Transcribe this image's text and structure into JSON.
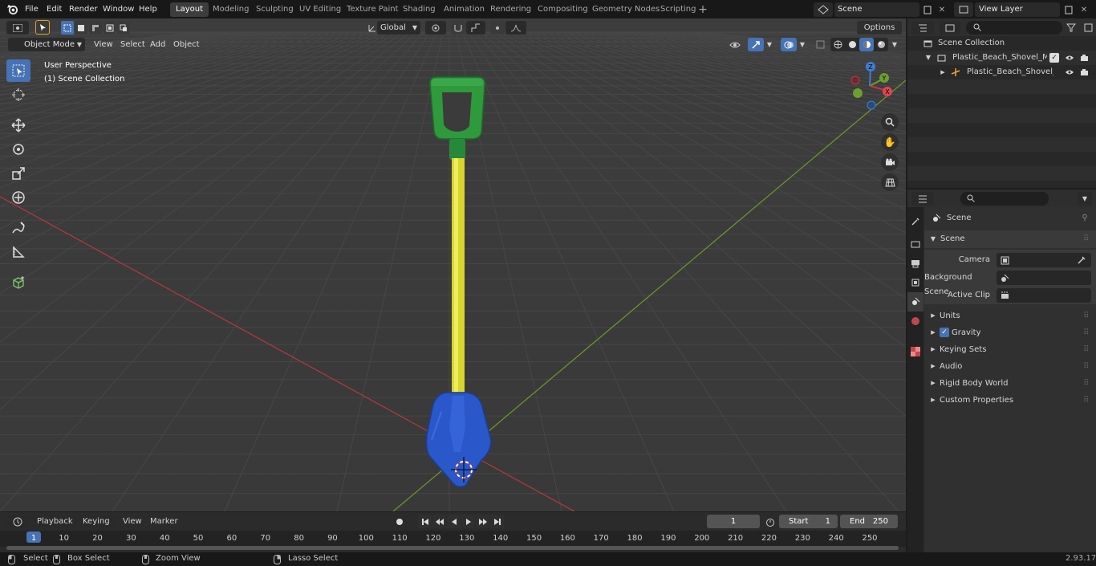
{
  "app": {
    "logo": "blender-icon",
    "version": "2.93.17"
  },
  "menu": [
    "File",
    "Edit",
    "Render",
    "Window",
    "Help"
  ],
  "workspaces": [
    "Layout",
    "Modeling",
    "Sculpting",
    "UV Editing",
    "Texture Paint",
    "Shading",
    "Animation",
    "Rendering",
    "Compositing",
    "Geometry Nodes",
    "Scripting"
  ],
  "active_workspace": "Layout",
  "scene_field": "Scene",
  "view_layer_field": "View Layer",
  "viewport_header": {
    "mode": "Object Mode",
    "menus": [
      "View",
      "Select",
      "Add",
      "Object"
    ],
    "transform": "Global",
    "options": "Options"
  },
  "viewport_overlay": {
    "line1": "User Perspective",
    "line2": "(1) Scene Collection"
  },
  "gizmo": {
    "x": "X",
    "y": "Y",
    "z": "Z"
  },
  "outliner": {
    "root": "Scene Collection",
    "collection": "Plastic_Beach_Shovel_Multico",
    "object": "Plastic_Beach_Shovel_Mu"
  },
  "properties": {
    "context": "Scene",
    "panel": "Scene",
    "camera_label": "Camera",
    "bgscene_label": "Background Scene",
    "clip_label": "Active Clip",
    "sections": [
      "Units",
      "Gravity",
      "Keying Sets",
      "Audio",
      "Rigid Body World",
      "Custom Properties"
    ]
  },
  "timeline": {
    "menus": [
      "Playback",
      "Keying",
      "View",
      "Marker"
    ],
    "current_frame": "1",
    "start_label": "Start",
    "start": "1",
    "end_label": "End",
    "end": "250",
    "ticks": [
      "1",
      "10",
      "20",
      "30",
      "40",
      "50",
      "60",
      "70",
      "80",
      "90",
      "100",
      "110",
      "120",
      "130",
      "140",
      "150",
      "160",
      "170",
      "180",
      "190",
      "200",
      "210",
      "220",
      "230",
      "240",
      "250"
    ]
  },
  "statusbar": {
    "select": "Select",
    "box_select": "Box Select",
    "zoom_view": "Zoom View",
    "lasso_select": "Lasso Select"
  },
  "colors": {
    "accent": "#4772b3",
    "x_axis": "#c2383f",
    "y_axis": "#6d9f2f",
    "handle_green": "#2e9a3c",
    "shaft_yellow": "#e4e23a",
    "blade_blue": "#2a57c9"
  }
}
